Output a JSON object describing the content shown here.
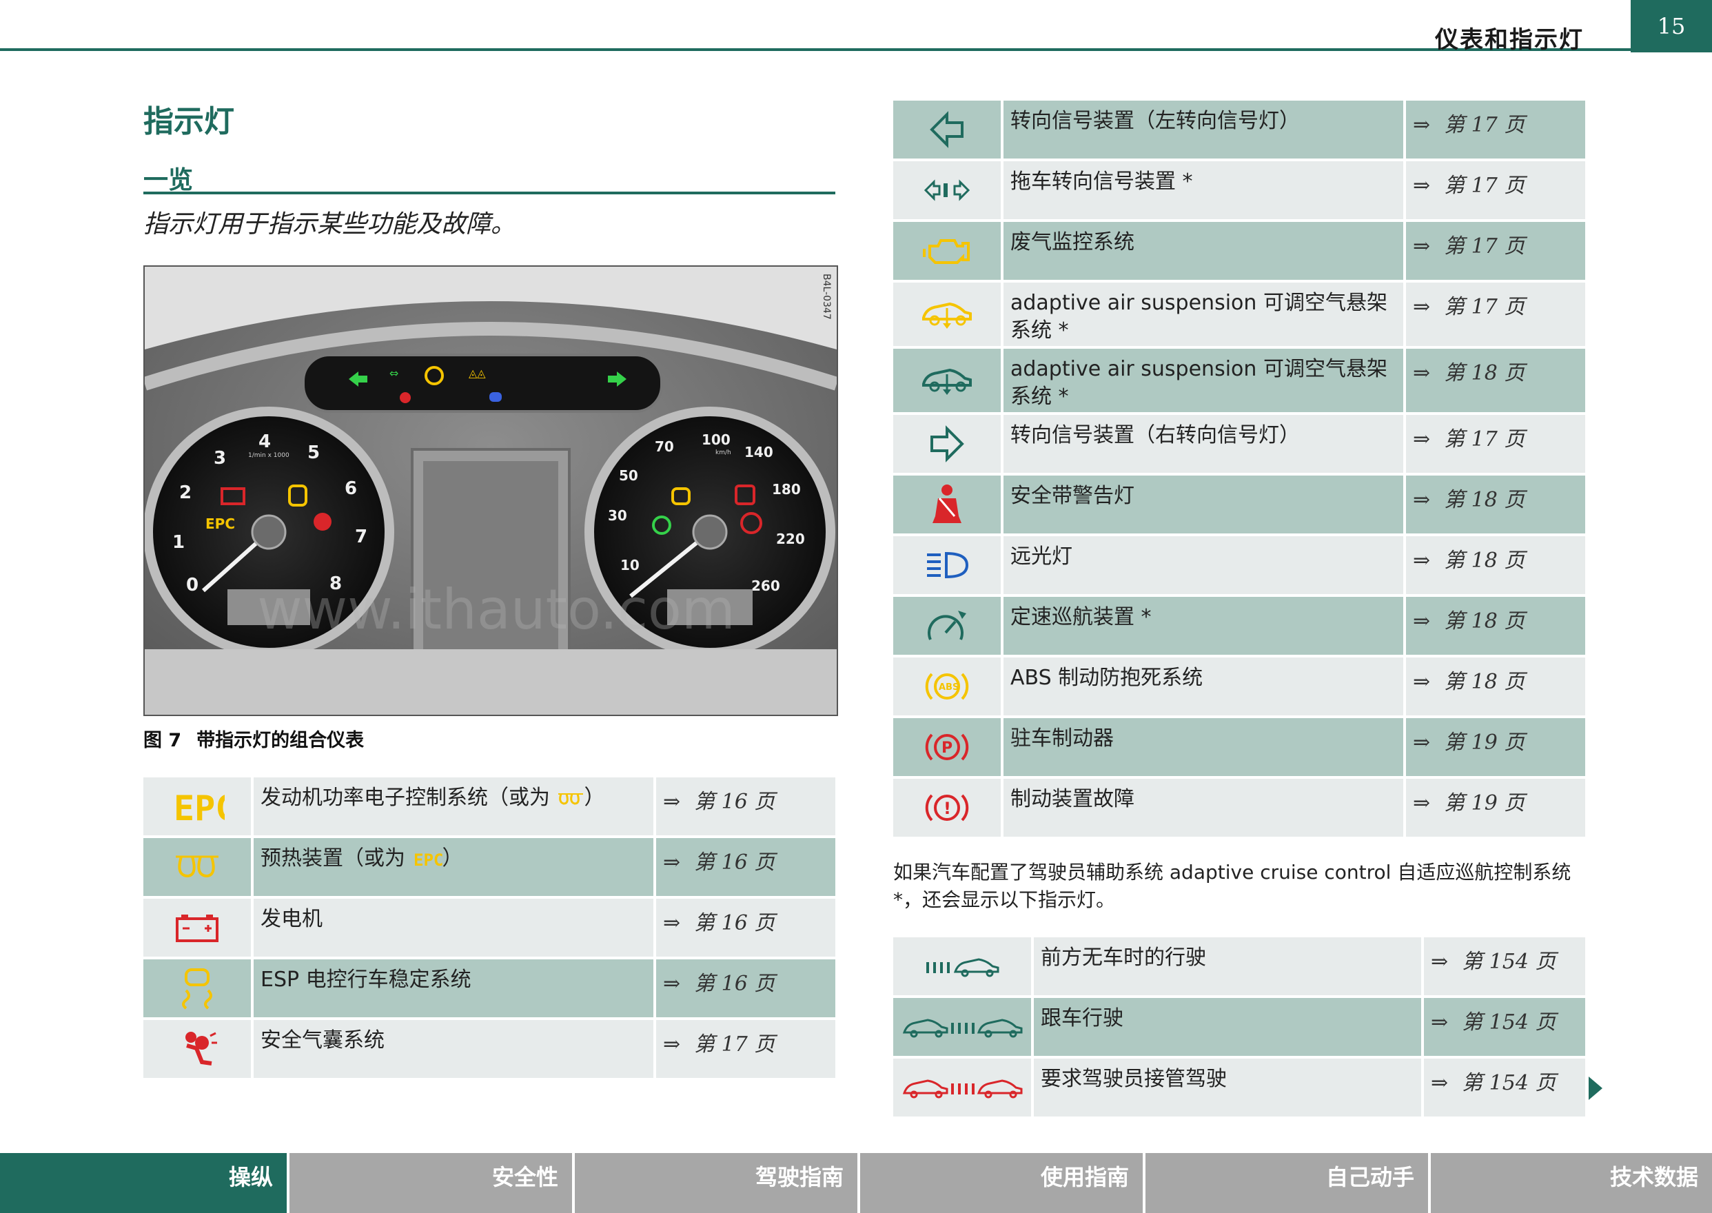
{
  "header": {
    "section_title": "仪表和指示灯",
    "page_number": "15"
  },
  "title": "指示灯",
  "subtitle": "一览",
  "intro": "指示灯用于指示某些功能及故障。",
  "figure": {
    "side_code": "B4L-0347",
    "caption_num": "图 7",
    "caption_text": "带指示灯的组合仪表",
    "watermark": "www.ithauto.com",
    "tach_labels": [
      "0",
      "1",
      "2",
      "3",
      "4",
      "5",
      "6",
      "7",
      "8"
    ],
    "tach_subtitle": "1/min x 1000",
    "speed_labels": [
      "10",
      "30",
      "50",
      "70",
      "100",
      "140",
      "180",
      "220",
      "260"
    ],
    "speed_unit": "km/h",
    "epc_label": "EPC"
  },
  "left_table": [
    {
      "icon": "epc-icon",
      "desc": "发动机功率电子控制系统（或为",
      "desc_suffix": "）",
      "ref": "第 16 页",
      "shade": "light"
    },
    {
      "icon": "glow-plug-icon",
      "desc": "预热装置（或为",
      "desc_suffix": "）",
      "ref": "第 16 页",
      "shade": "dark"
    },
    {
      "icon": "battery-icon",
      "desc": "发电机",
      "ref": "第 16 页",
      "shade": "light"
    },
    {
      "icon": "esp-icon",
      "desc": "ESP 电控行车稳定系统",
      "ref": "第 16 页",
      "shade": "dark"
    },
    {
      "icon": "airbag-icon",
      "desc": "安全气囊系统",
      "ref": "第 17 页",
      "shade": "light"
    }
  ],
  "right_table": [
    {
      "icon": "turn-left-icon",
      "desc": "转向信号装置（左转向信号灯）",
      "ref": "第 17 页",
      "shade": "dark"
    },
    {
      "icon": "trailer-turn-icon",
      "desc": "拖车转向信号装置 *",
      "ref": "第 17 页",
      "shade": "light"
    },
    {
      "icon": "engine-check-icon",
      "desc": "废气监控系统",
      "ref": "第 17 页",
      "shade": "dark"
    },
    {
      "icon": "suspension-yellow-icon",
      "desc": "adaptive air suspension 可调空气悬架系统 *",
      "ref": "第 17 页",
      "shade": "light"
    },
    {
      "icon": "suspension-green-icon",
      "desc": "adaptive air suspension 可调空气悬架系统 *",
      "ref": "第 18 页",
      "shade": "dark"
    },
    {
      "icon": "turn-right-icon",
      "desc": "转向信号装置（右转向信号灯）",
      "ref": "第 17 页",
      "shade": "light"
    },
    {
      "icon": "seatbelt-icon",
      "desc": "安全带警告灯",
      "ref": "第 18 页",
      "shade": "dark"
    },
    {
      "icon": "high-beam-icon",
      "desc": "远光灯",
      "ref": "第 18 页",
      "shade": "light"
    },
    {
      "icon": "cruise-control-icon",
      "desc": "定速巡航装置 *",
      "ref": "第 18 页",
      "shade": "dark"
    },
    {
      "icon": "abs-icon",
      "desc": "ABS 制动防抱死系统",
      "ref": "第 18 页",
      "shade": "light"
    },
    {
      "icon": "parking-brake-icon",
      "desc": "驻车制动器",
      "ref": "第 19 页",
      "shade": "dark"
    },
    {
      "icon": "brake-fault-icon",
      "desc": "制动装置故障",
      "ref": "第 19 页",
      "shade": "light"
    }
  ],
  "acc_paragraph": "如果汽车配置了驾驶员辅助系统 adaptive cruise control 自适应巡航控制系统 *，还会显示以下指示灯。",
  "acc_table": [
    {
      "icon": "acc-free-road-icon",
      "desc": "前方无车时的行驶",
      "ref": "第 154 页",
      "shade": "light"
    },
    {
      "icon": "acc-follow-icon",
      "desc": "跟车行驶",
      "ref": "第 154 页",
      "shade": "dark"
    },
    {
      "icon": "acc-takeover-icon",
      "desc": "要求驾驶员接管驾驶",
      "ref": "第 154 页",
      "shade": "light"
    }
  ],
  "ref_arrow": "⇒",
  "footer_tabs": [
    {
      "label": "操纵",
      "active": true
    },
    {
      "label": "安全性",
      "active": false
    },
    {
      "label": "驾驶指南",
      "active": false
    },
    {
      "label": "使用指南",
      "active": false
    },
    {
      "label": "自己动手",
      "active": false
    },
    {
      "label": "技术数据",
      "active": false
    }
  ],
  "colors": {
    "accent": "#1f6b5e",
    "row_dark": "#afc9c2",
    "row_light": "#e7ebeb",
    "warn_yellow": "#f5c400",
    "warn_red": "#d9262a"
  }
}
